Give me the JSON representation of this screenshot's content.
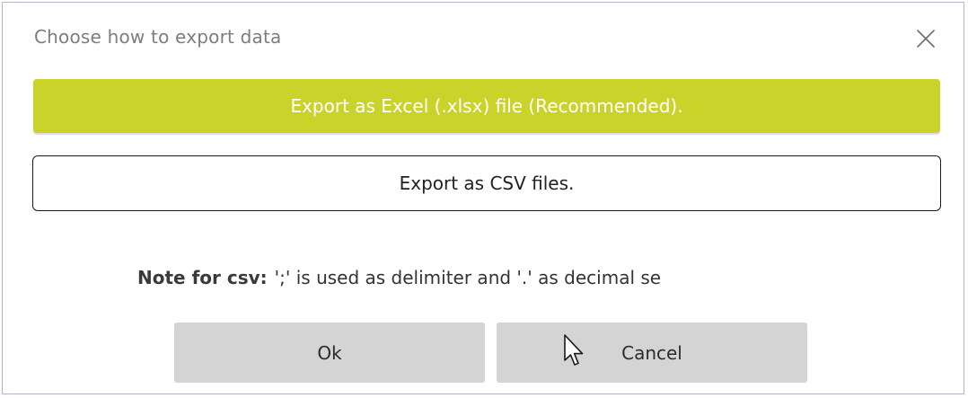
{
  "dialog": {
    "title": "Choose how to export data",
    "close_icon": "close-icon"
  },
  "options": {
    "excel_label": "Export as Excel (.xlsx) file (Recommended).",
    "csv_label": "Export as CSV files."
  },
  "note": {
    "label": "Note for csv:",
    "text": "';' is used as delimiter and '.' as decimal se"
  },
  "actions": {
    "ok_label": "Ok",
    "cancel_label": "Cancel"
  },
  "colors": {
    "accent": "#cad32a",
    "secondary_button": "#d4d4d4",
    "title_text": "#7d7d7d"
  },
  "icons": {
    "close": "close-icon",
    "cursor": "mouse-pointer-icon"
  }
}
